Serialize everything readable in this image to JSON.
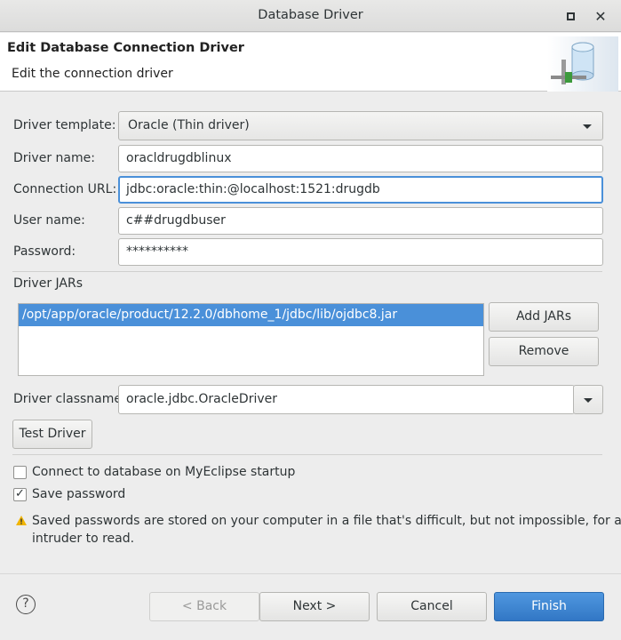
{
  "window": {
    "title": "Database Driver"
  },
  "header": {
    "title": "Edit Database Connection Driver",
    "subtitle": "Edit the connection driver",
    "icon": "database-icon"
  },
  "form": {
    "driver_template": {
      "label": "Driver template:",
      "value": "Oracle (Thin driver)"
    },
    "driver_name": {
      "label": "Driver name:",
      "value": "oracldrugdblinux"
    },
    "connection_url": {
      "label": "Connection URL:",
      "value": "jdbc:oracle:thin:@localhost:1521:drugdb"
    },
    "user_name": {
      "label": "User name:",
      "value": "c##drugdbuser"
    },
    "password": {
      "label": "Password:",
      "value": "**********"
    }
  },
  "jars": {
    "label": "Driver JARs",
    "items": [
      "/opt/app/oracle/product/12.2.0/dbhome_1/jdbc/lib/ojdbc8.jar"
    ],
    "add_label": "Add JARs",
    "remove_label": "Remove"
  },
  "classname": {
    "label": "Driver classname:",
    "value": "oracle.jdbc.OracleDriver"
  },
  "test_driver_label": "Test Driver",
  "options": {
    "connect_on_startup": {
      "label": "Connect to database on MyEclipse startup",
      "checked": false
    },
    "save_password": {
      "label": "Save password",
      "checked": true
    }
  },
  "warning": {
    "line1": "Saved passwords are stored on your computer in a file that's difficult, but not impossible, for an",
    "line2": "intruder to read."
  },
  "buttons": {
    "back": "< Back",
    "next": "Next >",
    "cancel": "Cancel",
    "finish": "Finish"
  },
  "help_glyph": "?",
  "colors": {
    "accent": "#4a90d9",
    "primary_button": "#3a82d0",
    "warning": "#f0b400"
  }
}
